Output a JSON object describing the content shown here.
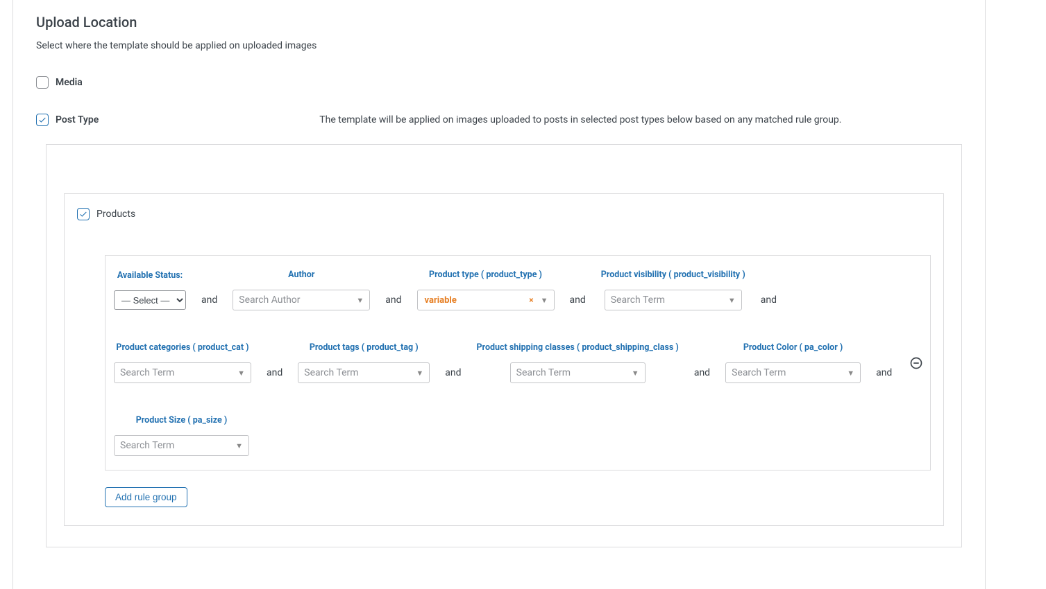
{
  "section": {
    "title": "Upload Location",
    "description": "Select where the template should be applied on uploaded images"
  },
  "checkboxes": {
    "media_label": "Media",
    "posttype_label": "Post Type",
    "posttype_help": "The template will be applied on images uploaded to posts in selected post types below based on any matched rule group.",
    "products_label": "Products"
  },
  "and": "and",
  "fields": {
    "status": {
      "label": "Available Status:",
      "selected": "— Select —"
    },
    "author": {
      "label": "Author",
      "placeholder": "Search Author"
    },
    "product_type": {
      "label": "Product type ( product_type )",
      "value": "variable"
    },
    "visibility": {
      "label": "Product visibility ( product_visibility )",
      "placeholder": "Search Term"
    },
    "categories": {
      "label": "Product categories ( product_cat )",
      "placeholder": "Search Term"
    },
    "tags": {
      "label": "Product tags ( product_tag )",
      "placeholder": "Search Term"
    },
    "shipping": {
      "label": "Product shipping classes ( product_shipping_class )",
      "placeholder": "Search Term"
    },
    "color": {
      "label": "Product Color ( pa_color )",
      "placeholder": "Search Term"
    },
    "size": {
      "label": "Product Size ( pa_size )",
      "placeholder": "Search Term"
    }
  },
  "buttons": {
    "add_rule_group": "Add rule group"
  }
}
